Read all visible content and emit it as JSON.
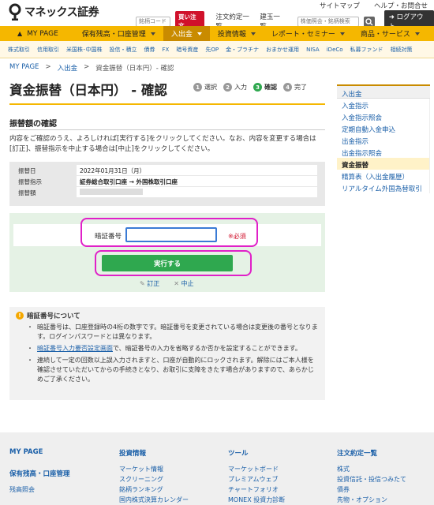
{
  "header": {
    "logo_text": "マネックス証券",
    "top_links": [
      "サイトマップ",
      "ヘルプ・お問合せ"
    ],
    "code_placeholder": "銘柄コード",
    "buy_button": "買い注文",
    "links": [
      "注文約定一覧",
      "建玉一覧"
    ],
    "search_placeholder": "株価照会・銘柄検索",
    "logout": "ログアウト"
  },
  "nav": {
    "items": [
      {
        "label": "MY PAGE",
        "caret": false
      },
      {
        "label": "保有残高・口座管理",
        "caret": true
      },
      {
        "label": "入出金",
        "caret": true,
        "active": true
      },
      {
        "label": "投資情報",
        "caret": true
      },
      {
        "label": "レポート・セミナー",
        "caret": true
      },
      {
        "label": "商品・サービス",
        "caret": true
      }
    ]
  },
  "subnav": [
    "株式取引",
    "信用取引",
    "米国株･中国株",
    "投信・積立",
    "債券",
    "FX",
    "暗号資産",
    "先OP",
    "金・プラチナ",
    "おまかせ運用",
    "NISA",
    "iDeCo",
    "私募ファンド",
    "相続対策"
  ],
  "breadcrumb": [
    "MY PAGE",
    ">",
    "入出金",
    ">",
    "資金振替（日本円）- 確認"
  ],
  "page_title": "資金振替（日本円） - 確認",
  "steps": [
    {
      "num": "1",
      "label": "選択"
    },
    {
      "num": "2",
      "label": "入力"
    },
    {
      "num": "3",
      "label": "確認",
      "current": true
    },
    {
      "num": "4",
      "label": "完了"
    }
  ],
  "section_title": "振替額の確認",
  "description": "内容をご確認のうえ、よろしければ[実行する]をクリックしてください。なお、内容を変更する場合は[訂正]、振替指示を中止する場合は[中止]をクリックしてください。",
  "table": [
    {
      "label": "振替日",
      "value": "2022年01月31日（月）"
    },
    {
      "label": "振替指示",
      "value": "証券総合取引口座 → 外国株取引口座"
    },
    {
      "label": "振替額",
      "value": ""
    }
  ],
  "form": {
    "pin_label": "暗証番号",
    "pin_value": "",
    "required": "※必須",
    "execute": "実行する",
    "correct": "訂正",
    "cancel": "中止"
  },
  "note": {
    "title": "暗証番号について",
    "items": [
      "暗証番号は、口座登録時の4桁の数字です。暗証番号を変更されている場合は変更後の番号となります。ログインパスワードとは異なります。",
      "で、暗証番号の入力を省略するか否かを設定することができます。",
      "連続して一定の回数以上誤入力されますと、口座が自動的にロックされます。解除にはご本人様を確認させていただいてからの手続きとなり、お取引に支障をきたす場合がありますので、あらかじめご了承ください。"
    ],
    "link_text": "暗証番号入力要否設定画面"
  },
  "sidebar": {
    "header": "入出金",
    "items": [
      {
        "label": "入金指示"
      },
      {
        "label": "入金指示照会"
      },
      {
        "label": "定期自動入金申込"
      },
      {
        "label": "出金指示"
      },
      {
        "label": "出金指示照会"
      },
      {
        "label": "資金振替",
        "active": true
      },
      {
        "label": "精算表（入出金履歴）"
      },
      {
        "label": "リアルタイム外国為替取引"
      }
    ]
  },
  "footer": {
    "col1": {
      "head": "MY PAGE",
      "sub": "保有残高・口座管理",
      "items": [
        "残高照会"
      ]
    },
    "col2": {
      "head": "投資情報",
      "items": [
        "マーケット情報",
        "スクリーニング",
        "銘柄ランキング",
        "国内株式決算カレンダー"
      ]
    },
    "col3": {
      "head": "ツール",
      "items": [
        "マーケットボード",
        "プレミアムウェブ",
        "チャートフォリオ",
        "MONEX 投資力診断"
      ]
    },
    "col4": {
      "head": "注文約定一覧",
      "items": [
        "株式",
        "投資信託・投信つみたて",
        "債券",
        "先物・オプション"
      ]
    }
  }
}
